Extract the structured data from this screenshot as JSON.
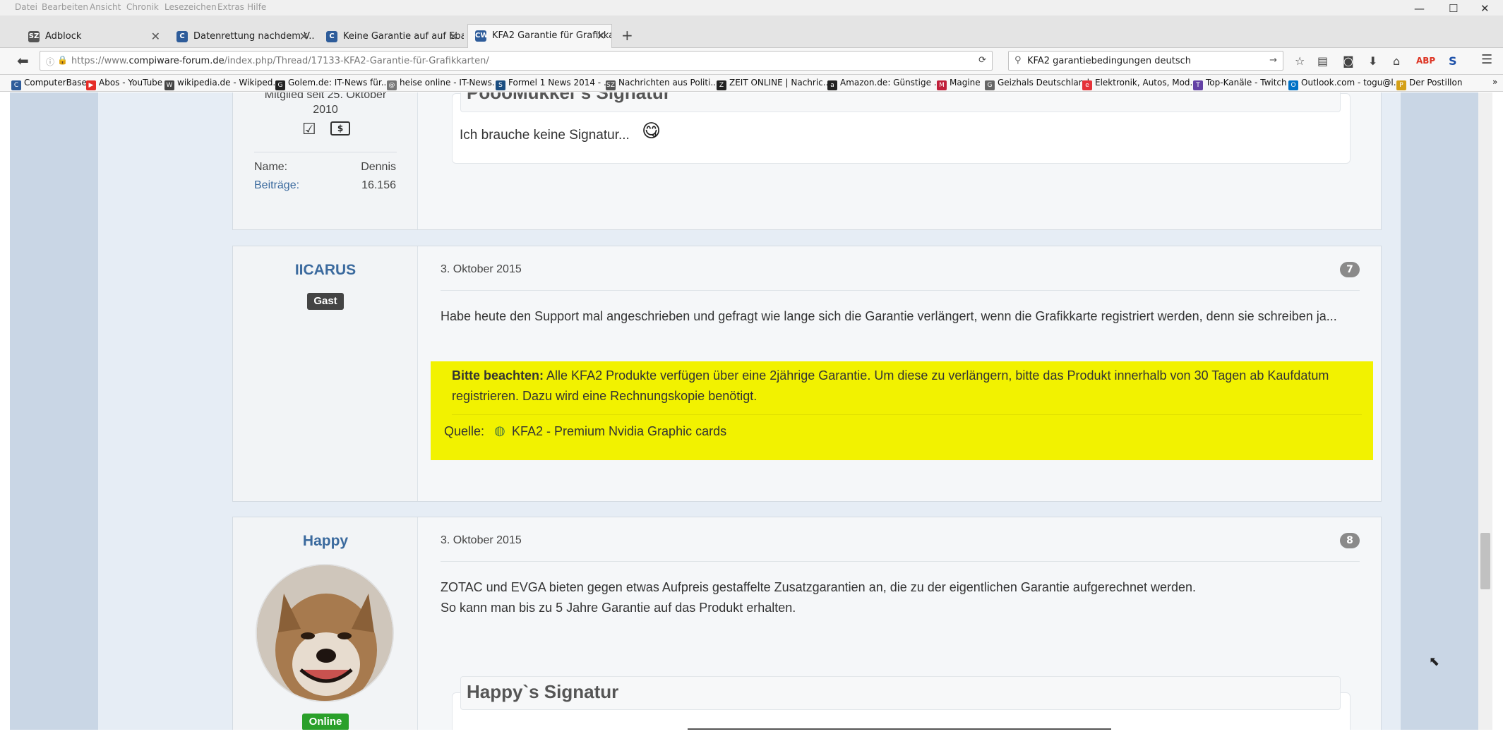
{
  "menu": [
    "Datei",
    "Bearbeiten",
    "Ansicht",
    "Chronik",
    "Lesezeichen",
    "Extras",
    "Hilfe"
  ],
  "window_controls": {
    "minimize": "—",
    "maximize": "☐",
    "close": "✕"
  },
  "tabs": [
    {
      "label": "Adblock",
      "favicon": "SZ",
      "favicon_color": "#555555"
    },
    {
      "label": "Datenrettung nachdem V...",
      "favicon": "C",
      "favicon_color": "#2e5c9a"
    },
    {
      "label": "Keine Garantie auf auf Eba...",
      "favicon": "C",
      "favicon_color": "#2e5c9a"
    },
    {
      "label": "KFA2 Garantie für Grafikka...",
      "favicon": "CW",
      "favicon_color": "#2e5c9a"
    }
  ],
  "new_tab_label": "+",
  "address": {
    "prefix": "https://www.",
    "domain": "compiware-forum.de",
    "path": "/index.php/Thread/17133-KFA2-Garantie-für-Grafikkarten/"
  },
  "search": {
    "value": "KFA2 garantiebedingungen deutsch"
  },
  "bookmarks": [
    {
      "label": "ComputerBase",
      "icon": "C",
      "color": "#2e5c9a"
    },
    {
      "label": "Abos - YouTube",
      "icon": "▶",
      "color": "#e52d27"
    },
    {
      "label": "wikipedia.de - Wikiped...",
      "icon": "W",
      "color": "#444444"
    },
    {
      "label": "Golem.de: IT-News für...",
      "icon": "G",
      "color": "#222222"
    },
    {
      "label": "heise online - IT-News...",
      "icon": "@",
      "color": "#777777"
    },
    {
      "label": "Formel 1 News 2014 - ...",
      "icon": "S",
      "color": "#1a4d80"
    },
    {
      "label": "Nachrichten aus Politi...",
      "icon": "SZ",
      "color": "#555555"
    },
    {
      "label": "ZEIT ONLINE | Nachric...",
      "icon": "Z",
      "color": "#222222"
    },
    {
      "label": "Amazon.de: Günstige ...",
      "icon": "a",
      "color": "#222222"
    },
    {
      "label": "Magine",
      "icon": "M",
      "color": "#c0203b"
    },
    {
      "label": "Geizhals Deutschland",
      "icon": "G",
      "color": "#666666"
    },
    {
      "label": "Elektronik, Autos, Mod...",
      "icon": "e",
      "color": "#e53238"
    },
    {
      "label": "Top-Kanäle - Twitch",
      "icon": "T",
      "color": "#6441a5"
    },
    {
      "label": "Outlook.com - togu@l...",
      "icon": "O",
      "color": "#0072c6"
    },
    {
      "label": "Der Postillon",
      "icon": "P",
      "color": "#d4a017"
    }
  ],
  "post6": {
    "member_since": "Mitglied seit 25. Oktober 2010",
    "name_label": "Name:",
    "name_value": "Dennis",
    "posts_label": "Beiträge:",
    "posts_value": "16.156",
    "signature_title": "PoooMukkel`s Signatur",
    "signature_text": "Ich brauche keine Signatur..."
  },
  "post7": {
    "username": "IICARUS",
    "badge": "Gast",
    "date": "3. Oktober 2015",
    "number": "7",
    "text": "Habe heute den Support mal angeschrieben und gefragt wie lange sich die Garantie verlängert, wenn die Grafikkarte registriert werden, denn sie schreiben ja...",
    "quote_bold": "Bitte beachten:",
    "quote_text": " Alle KFA2 Produkte verfügen über eine 2jährige Garantie. Um diese zu verlängern, bitte das Produkt innerhalb von 30 Tagen ab Kaufdatum registrieren. Dazu wird eine Rechnungskopie benötigt.",
    "source_label": "Quelle:",
    "source_link": "KFA2 - Premium Nvidia Graphic cards"
  },
  "post8": {
    "username": "Happy",
    "status": "Online",
    "date": "3. Oktober 2015",
    "number": "8",
    "line1": "ZOTAC und EVGA bieten gegen etwas Aufpreis gestaffelte Zusatzgarantien an, die zu der eigentlichen Garantie aufgerechnet werden.",
    "line2": "So kann man bis zu 5 Jahre Garantie auf das Produkt erhalten.",
    "signature_title": "Happy`s Signatur"
  },
  "colors": {
    "highlight": "#f2f200",
    "username": "#3b6a9e",
    "online": "#2aa02a",
    "guest": "#444444"
  }
}
